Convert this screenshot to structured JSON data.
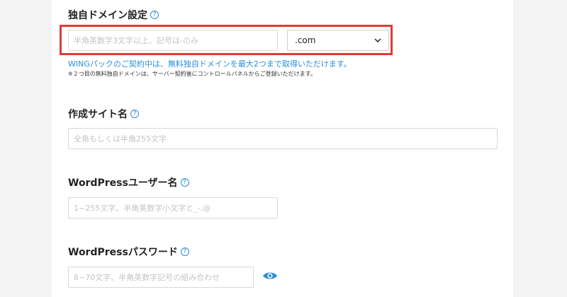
{
  "domain_section": {
    "label": "独自ドメイン設定",
    "help": "?",
    "input_placeholder": "半角英数字3文字以上、記号は-のみ",
    "tld_selected": ".com",
    "notice": "WINGパックのご契約中は、無料独自ドメインを最大2つまで取得いただけます。",
    "note": "※２つ目の無料独自ドメインは、サーバー契約後にコントロールパネルからご登録いただけます。"
  },
  "site_name": {
    "label": "作成サイト名",
    "help": "?",
    "placeholder": "全角もしくは半角255文字"
  },
  "wp_user": {
    "label": "WordPressユーザー名",
    "help": "?",
    "placeholder": "1~255文字、半角英数字小文字と_-.@"
  },
  "wp_password": {
    "label": "WordPressパスワード",
    "help": "?",
    "placeholder": "8~70文字、半角英数字記号の組み合わせ",
    "toggle_icon": "eye-icon"
  },
  "colors": {
    "accent": "#2a8fd6",
    "highlight": "#e53935"
  }
}
